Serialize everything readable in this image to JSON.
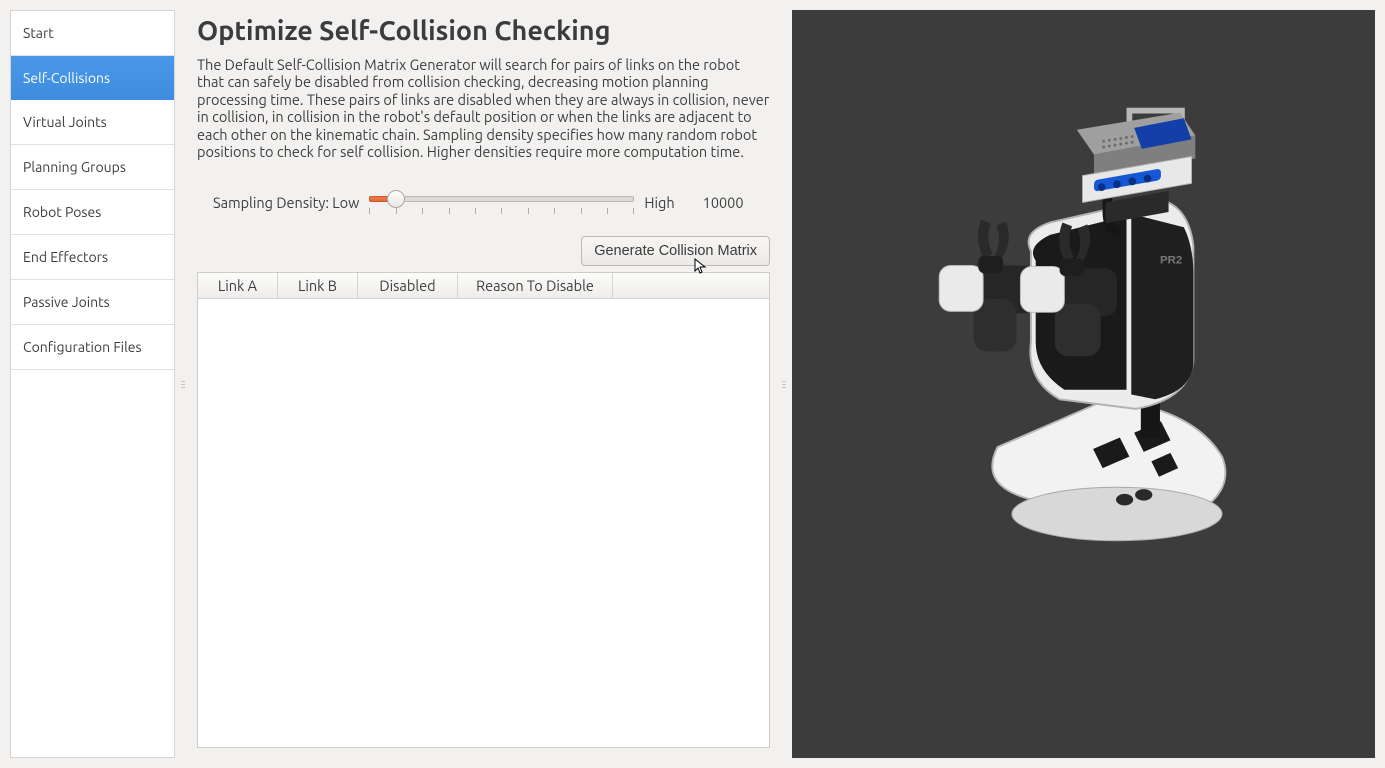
{
  "sidebar": {
    "items": [
      {
        "label": "Start"
      },
      {
        "label": "Self-Collisions"
      },
      {
        "label": "Virtual Joints"
      },
      {
        "label": "Planning Groups"
      },
      {
        "label": "Robot Poses"
      },
      {
        "label": "End Effectors"
      },
      {
        "label": "Passive Joints"
      },
      {
        "label": "Configuration Files"
      }
    ],
    "selected_index": 1
  },
  "main": {
    "title": "Optimize Self-Collision Checking",
    "description": "The Default Self-Collision Matrix Generator will search for pairs of links on the robot that can safely be disabled from collision checking, decreasing motion planning processing time. These pairs of links are disabled when they are always in collision, never in collision, in collision in the robot's default position or when the links are adjacent to each other on the kinematic chain. Sampling density specifies how many random robot positions to check for self collision. Higher densities require more computation time.",
    "density": {
      "label": "Sampling Density: Low",
      "high_label": "High",
      "value_display": "10000",
      "thumb_percent": 10
    },
    "generate_button": "Generate Collision Matrix",
    "table": {
      "columns": [
        "Link A",
        "Link B",
        "Disabled",
        "Reason To Disable"
      ],
      "rows": []
    }
  }
}
